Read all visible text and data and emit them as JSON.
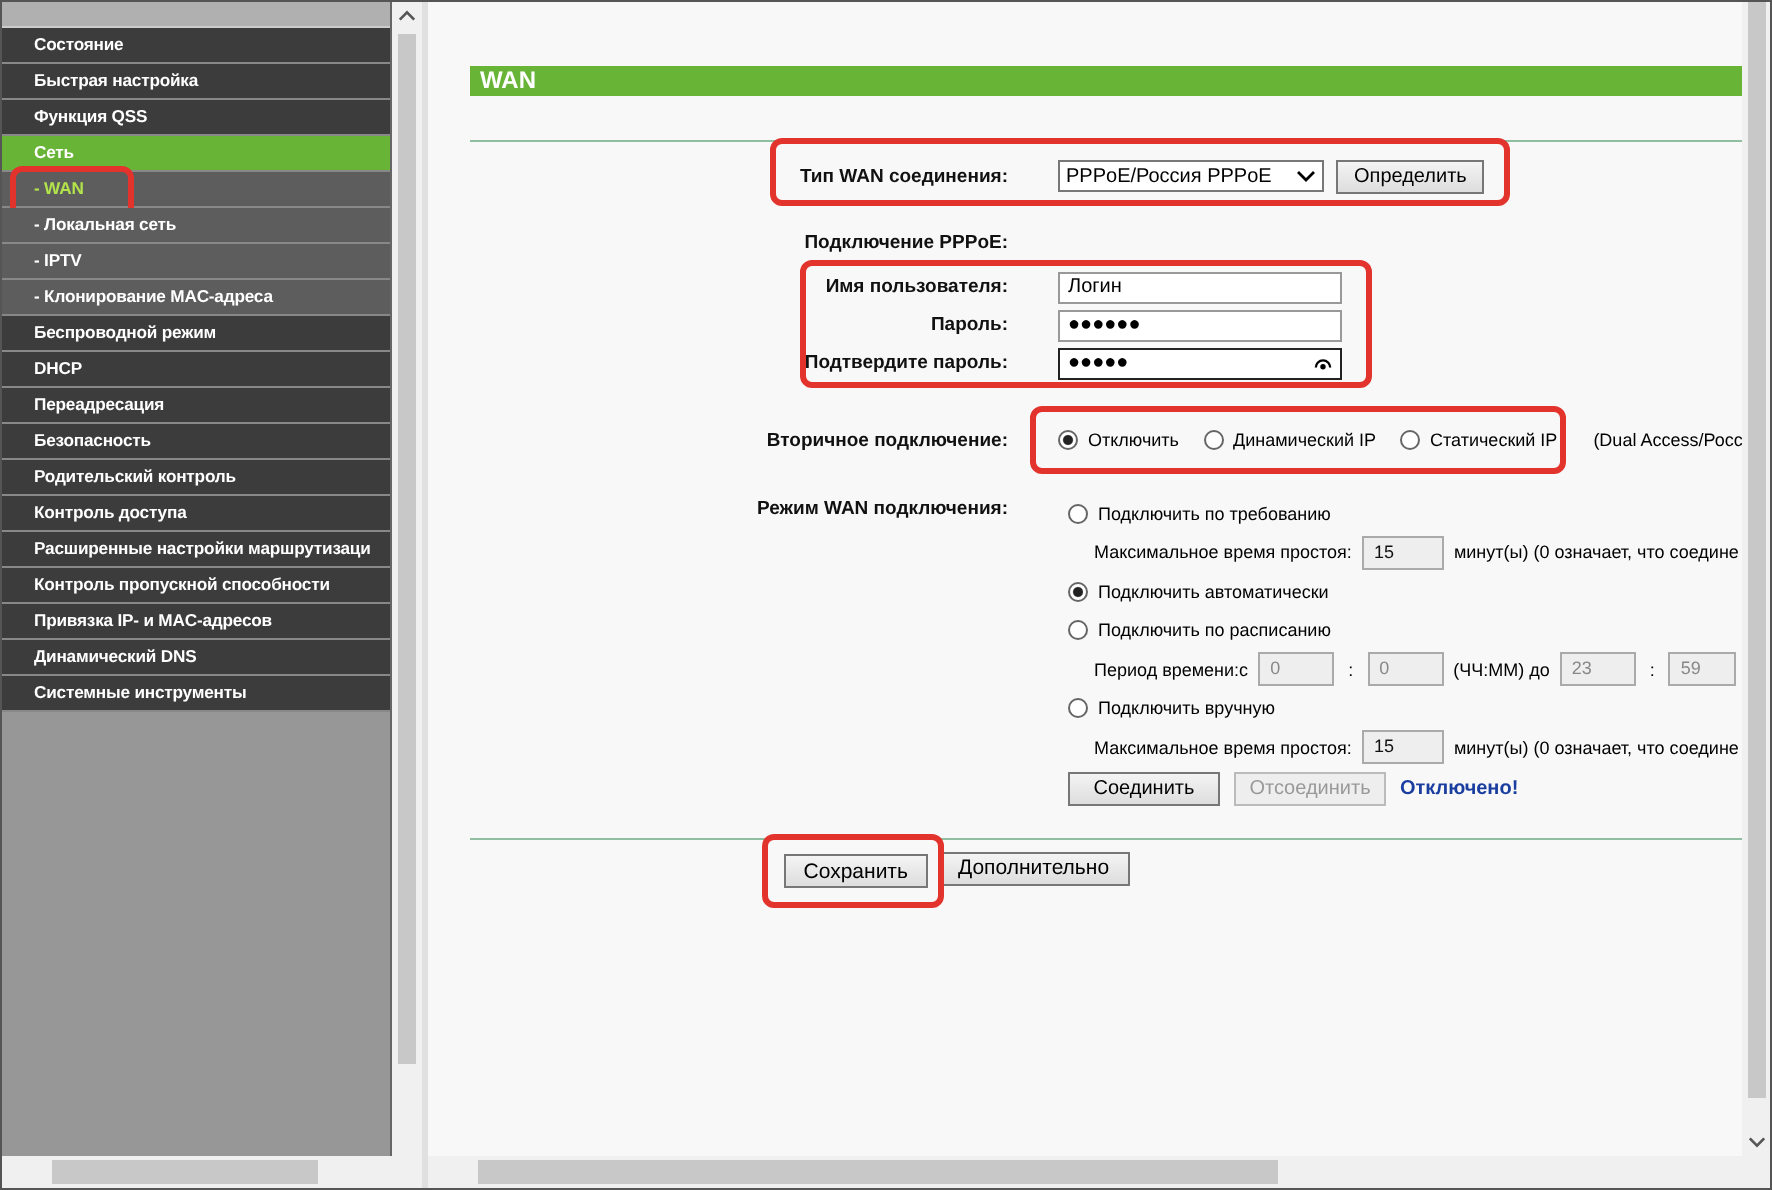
{
  "sidebar": {
    "items": [
      {
        "label": "Состояние",
        "kind": "section",
        "selected": false,
        "highlighted": false
      },
      {
        "label": "Быстрая настройка",
        "kind": "section",
        "selected": false,
        "highlighted": false
      },
      {
        "label": "Функция QSS",
        "kind": "section",
        "selected": false,
        "highlighted": false
      },
      {
        "label": "Сеть",
        "kind": "section",
        "selected": true,
        "highlighted": false
      },
      {
        "label": "- WAN",
        "kind": "sub",
        "selected": true,
        "highlighted": true
      },
      {
        "label": "- Локальная сеть",
        "kind": "sub",
        "selected": false,
        "highlighted": false
      },
      {
        "label": "- IPTV",
        "kind": "sub",
        "selected": false,
        "highlighted": false
      },
      {
        "label": "- Клонирование MAC-адреса",
        "kind": "sub",
        "selected": false,
        "highlighted": false
      },
      {
        "label": "Беспроводной режим",
        "kind": "section",
        "selected": false,
        "highlighted": false
      },
      {
        "label": "DHCP",
        "kind": "section",
        "selected": false,
        "highlighted": false
      },
      {
        "label": "Переадресация",
        "kind": "section",
        "selected": false,
        "highlighted": false
      },
      {
        "label": "Безопасность",
        "kind": "section",
        "selected": false,
        "highlighted": false
      },
      {
        "label": "Родительский контроль",
        "kind": "section",
        "selected": false,
        "highlighted": false
      },
      {
        "label": "Контроль доступа",
        "kind": "section",
        "selected": false,
        "highlighted": false
      },
      {
        "label": "Расширенные настройки маршрутизаци",
        "kind": "section",
        "selected": false,
        "highlighted": false
      },
      {
        "label": "Контроль пропускной способности",
        "kind": "section",
        "selected": false,
        "highlighted": false
      },
      {
        "label": "Привязка IP- и MAC-адресов",
        "kind": "section",
        "selected": false,
        "highlighted": false
      },
      {
        "label": "Динамический DNS",
        "kind": "section",
        "selected": false,
        "highlighted": false
      },
      {
        "label": "Системные инструменты",
        "kind": "section",
        "selected": false,
        "highlighted": false
      }
    ]
  },
  "page": {
    "title": "WAN",
    "connection_type": {
      "label": "Тип WAN соединения:",
      "value": "PPPoE/Россия PPPoE",
      "button": "Определить",
      "highlighted": true
    },
    "pppoe": {
      "heading": "Подключение PPPoE:",
      "highlighted": true,
      "fields": [
        {
          "label": "Имя пользователя:",
          "value": "Логин",
          "reveal": false
        },
        {
          "label": "Пароль:",
          "value": "●●●●●●",
          "reveal": false
        },
        {
          "label": "Подтвердите пароль:",
          "value": "●●●●●",
          "reveal": true
        }
      ]
    },
    "secondary": {
      "label": "Вторичное подключение:",
      "highlighted": true,
      "note": "(Dual Access/Росс",
      "options": [
        {
          "label": "Отключить",
          "selected": true
        },
        {
          "label": "Динамический IP",
          "selected": false
        },
        {
          "label": "Статический IP",
          "selected": false
        }
      ]
    },
    "mode": {
      "label": "Режим WAN подключения:",
      "rows": [
        {
          "kind": "radio",
          "label": "Подключить по требованию",
          "selected": false
        },
        {
          "kind": "idle",
          "label": "Максимальное время простоя:",
          "value": "15",
          "suffix": "минут(ы) (0 означает, что соедине"
        },
        {
          "kind": "radio",
          "label": "Подключить автоматически",
          "selected": true
        },
        {
          "kind": "radio",
          "label": "Подключить по расписанию",
          "selected": false
        },
        {
          "kind": "period",
          "label": "Период времени:с",
          "from_h": "0",
          "sep1": ":",
          "from_m": "0",
          "to_label": "(ЧЧ:ММ) до",
          "to_h": "23",
          "sep2": ":",
          "to_m": "59"
        },
        {
          "kind": "radio",
          "label": "Подключить вручную",
          "selected": false
        },
        {
          "kind": "idle",
          "label": "Максимальное время простоя:",
          "value": "15",
          "suffix": "минут(ы) (0 означает, что соедине"
        }
      ],
      "connect": {
        "label": "Соединить",
        "disabled": false
      },
      "disconnect": {
        "label": "Отсоединить",
        "disabled": true
      },
      "status": "Отключено!"
    },
    "save": {
      "label": "Сохранить",
      "highlighted": true
    },
    "advanced": "Дополнительно"
  }
}
